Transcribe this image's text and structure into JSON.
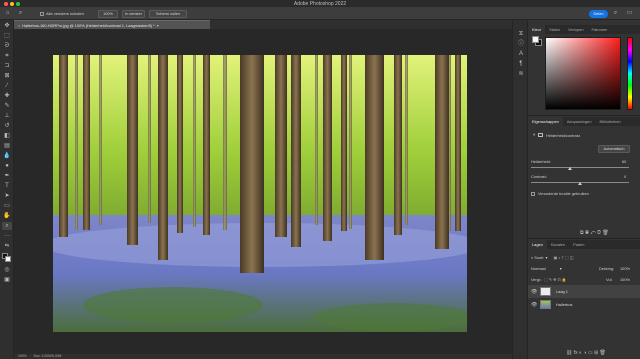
{
  "app": {
    "title": "Adobe Photoshop 2022"
  },
  "window_controls": {
    "close_color": "#ff5f57",
    "minimize_color": "#febc2e",
    "zoom_color": "#28c840"
  },
  "options_bar": {
    "home_icon": "home-icon",
    "zoom_tool_icon": "zoom-icon",
    "checkbox_label": "Alle vensters schalen",
    "zoom_percent": "100%",
    "fit_label": "In venster",
    "fill_label": "Scherm vullen",
    "share_label": "Delen",
    "search_icon": "search-icon",
    "workspace_icon": "workspace-icon",
    "accent_color": "#1473e6"
  },
  "document": {
    "tab_label": "Hallerbos-160-HDRPro.jpg @ 100% (Helderheid/contrast 1, Laagmasker/8) *"
  },
  "status_bar": {
    "zoom": "100%",
    "info": "Doc: 3,00M/5,00M"
  },
  "color_panel": {
    "tabs": [
      "Kleur",
      "Stalen",
      "Verlopen",
      "Patronen"
    ],
    "active_tab": "Kleur",
    "foreground": "#f5f5f5",
    "background": "#111111"
  },
  "properties_panel": {
    "tabs": [
      "Eigenschappen",
      "Aanpassingen",
      "Bibliotheken"
    ],
    "active_tab": "Eigenschappen",
    "adjustment_name": "Helderheid/contrast",
    "auto_button": "Automatisch",
    "brightness_label": "Helderheid:",
    "brightness_value": "60",
    "contrast_label": "Contrast:",
    "contrast_value": "0",
    "legacy_label": "Verouderde functie gebruiken"
  },
  "layers_panel": {
    "tabs": [
      "Lagen",
      "Kanalen",
      "Paden"
    ],
    "active_tab": "Lagen",
    "filter_label": "Soort",
    "blend_mode": "Normaal",
    "opacity_label": "Dekking:",
    "opacity_value": "100%",
    "lock_label": "Vergr.:",
    "fill_label": "Vul:",
    "fill_value": "100%",
    "layers": [
      {
        "name": "Laag 1"
      },
      {
        "name": "Hallerbos"
      }
    ]
  }
}
